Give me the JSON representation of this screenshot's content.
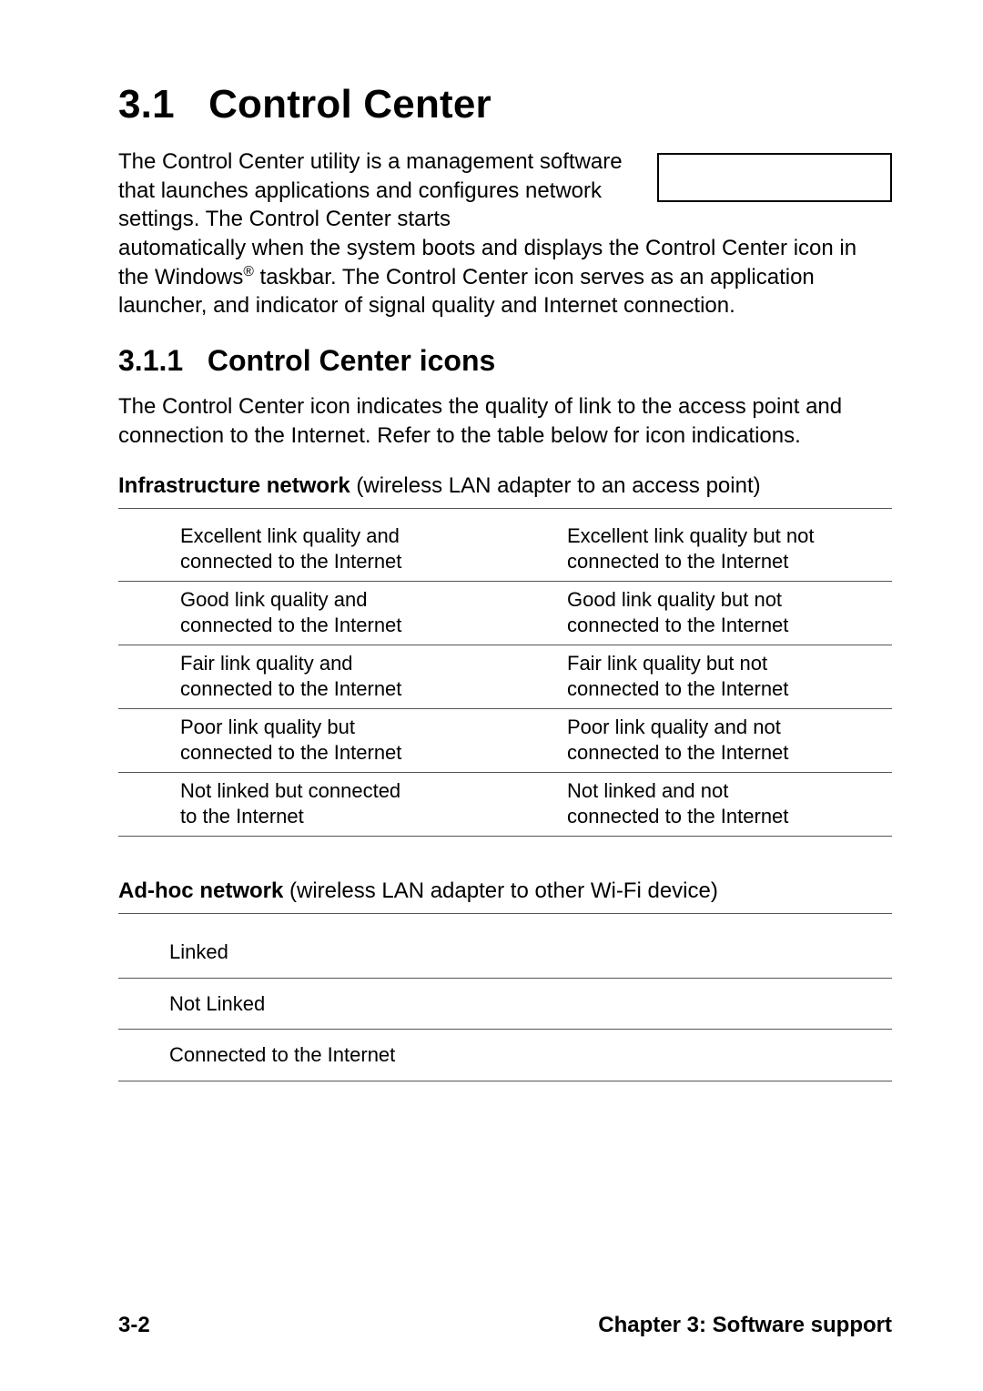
{
  "heading": {
    "number": "3.1",
    "title": "Control Center"
  },
  "intro_part1": "The Control Center utility is a management software that launches applications and configures network settings. The Control Center starts",
  "intro_part2_a": "automatically when the system boots and displays the Control Center icon in the Windows",
  "intro_part2_b": " taskbar. The Control Center icon serves as an application launcher, and indicator of signal quality and Internet connection.",
  "reg": "®",
  "sub1": {
    "number": "3.1.1",
    "title": "Control Center icons"
  },
  "sub1_para": "The Control Center icon indicates the quality of link to the access point and connection to the Internet. Refer to the table below for icon indications.",
  "infra_label_bold": "Infrastructure network",
  "infra_label_rest": " (wireless LAN adapter to an access point)",
  "infra_rows": [
    {
      "l1": "Excellent link quality and",
      "l2": "connected to the Internet",
      "r1": "Excellent link quality but not",
      "r2": "connected to the Internet"
    },
    {
      "l1": "Good link quality and",
      "l2": "connected to the Internet",
      "r1": "Good link quality but not",
      "r2": "connected to the Internet"
    },
    {
      "l1": "Fair link quality and",
      "l2": "connected to the Internet",
      "r1": "Fair link quality but not",
      "r2": "connected to the Internet"
    },
    {
      "l1": "Poor link quality but",
      "l2": "connected to the Internet",
      "r1": "Poor link quality and not",
      "r2": "connected to the Internet"
    },
    {
      "l1": "Not linked but connected",
      "l2": "to the Internet",
      "r1": "Not linked and not",
      "r2": "connected to the Internet"
    }
  ],
  "adhoc_label_bold": "Ad-hoc network",
  "adhoc_label_rest": " (wireless LAN adapter to other Wi-Fi device)",
  "adhoc_rows": [
    {
      "text": "Linked"
    },
    {
      "text": "Not Linked"
    },
    {
      "text": "Connected to the Internet"
    }
  ],
  "footer": {
    "page": "3-2",
    "chapter": "Chapter 3: Software support"
  }
}
